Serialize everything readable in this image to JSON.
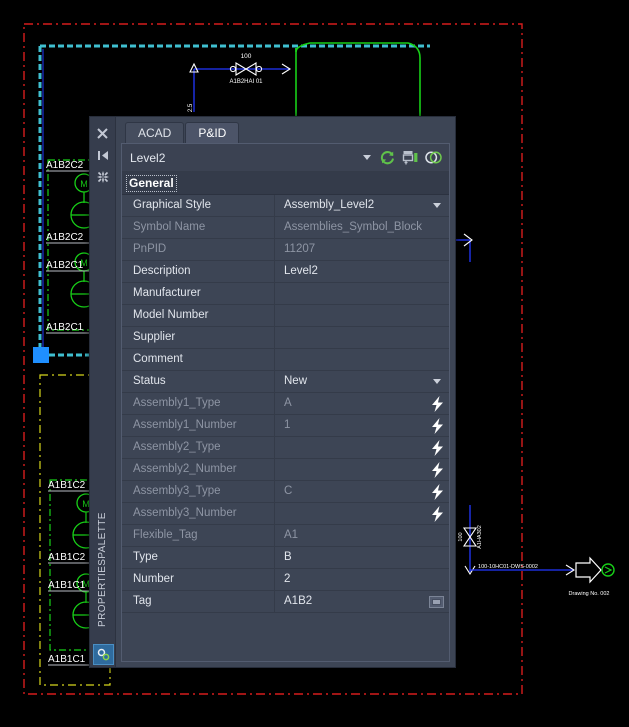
{
  "palette": {
    "strip": {
      "title": "PROPERTIESPALETTE",
      "close_label": "Close",
      "autohide_label": "Auto-hide",
      "properties_label": "Properties",
      "bottom_label": "Palette Options"
    },
    "tabs": [
      {
        "label": "ACAD",
        "active": false
      },
      {
        "label": "P&ID",
        "active": true
      }
    ],
    "selector": {
      "value": "Level2",
      "tools": [
        {
          "name": "refresh-icon",
          "title": "Refresh"
        },
        {
          "name": "quick-select-icon",
          "title": "Quick Select"
        },
        {
          "name": "toggle-value-icon",
          "title": "Toggle"
        }
      ]
    },
    "category": "General",
    "properties": [
      {
        "name": "Graphical Style",
        "value": "Assembly_Level2",
        "name_dim": false,
        "value_dim": false,
        "control": "dropdown"
      },
      {
        "name": "Symbol Name",
        "value": "Assemblies_Symbol_Block",
        "name_dim": true,
        "value_dim": true,
        "control": "none"
      },
      {
        "name": "PnPID",
        "value": "11207",
        "name_dim": true,
        "value_dim": true,
        "control": "none"
      },
      {
        "name": "Description",
        "value": "Level2",
        "name_dim": false,
        "value_dim": false,
        "control": "none"
      },
      {
        "name": "Manufacturer",
        "value": "",
        "name_dim": false,
        "value_dim": false,
        "control": "none"
      },
      {
        "name": "Model Number",
        "value": "",
        "name_dim": false,
        "value_dim": false,
        "control": "none"
      },
      {
        "name": "Supplier",
        "value": "",
        "name_dim": false,
        "value_dim": false,
        "control": "none"
      },
      {
        "name": "Comment",
        "value": "",
        "name_dim": false,
        "value_dim": false,
        "control": "none"
      },
      {
        "name": "Status",
        "value": "New",
        "name_dim": false,
        "value_dim": false,
        "control": "dropdown"
      },
      {
        "name": "Assembly1_Type",
        "value": "A",
        "name_dim": true,
        "value_dim": true,
        "control": "bolt"
      },
      {
        "name": "Assembly1_Number",
        "value": "1",
        "name_dim": true,
        "value_dim": true,
        "control": "bolt"
      },
      {
        "name": "Assembly2_Type",
        "value": "",
        "name_dim": true,
        "value_dim": true,
        "control": "bolt"
      },
      {
        "name": "Assembly2_Number",
        "value": "",
        "name_dim": true,
        "value_dim": true,
        "control": "bolt"
      },
      {
        "name": "Assembly3_Type",
        "value": "C",
        "name_dim": true,
        "value_dim": true,
        "control": "bolt"
      },
      {
        "name": "Assembly3_Number",
        "value": "",
        "name_dim": true,
        "value_dim": true,
        "control": "bolt"
      },
      {
        "name": "Flexible_Tag",
        "value": "A1",
        "name_dim": true,
        "value_dim": true,
        "control": "none"
      },
      {
        "name": "Type",
        "value": "B",
        "name_dim": false,
        "value_dim": false,
        "control": "none"
      },
      {
        "name": "Number",
        "value": "2",
        "name_dim": false,
        "value_dim": false,
        "control": "none"
      },
      {
        "name": "Tag",
        "value": "A1B2",
        "name_dim": false,
        "value_dim": false,
        "control": "field"
      }
    ]
  },
  "drawing": {
    "top_valve_size": "100",
    "top_valve_tag": "A1B2HAI 01",
    "top_dim_text": "2.5",
    "right_valve_tag": "A1HA302",
    "right_valve_size": "100",
    "line_tag": "100-10HC01-DWS-0002",
    "off_page_label": "Drawing No. 002",
    "equipment_upper": [
      "A1B2C2",
      "A1B2C2",
      "A1B2C1",
      "A1B2C1"
    ],
    "equipment_lower": [
      "A1B1C2",
      "A1B1C2",
      "A1B1C1",
      "A1B1C1"
    ],
    "motor_label": "M",
    "colors": {
      "border_red": "#d61c1c",
      "pipe_blue": "#2237ff",
      "equipment_green": "#18d018",
      "group_yellow": "#d6d61c",
      "grip_blue": "#1f8fff",
      "annotation_white": "#ffffff"
    }
  }
}
